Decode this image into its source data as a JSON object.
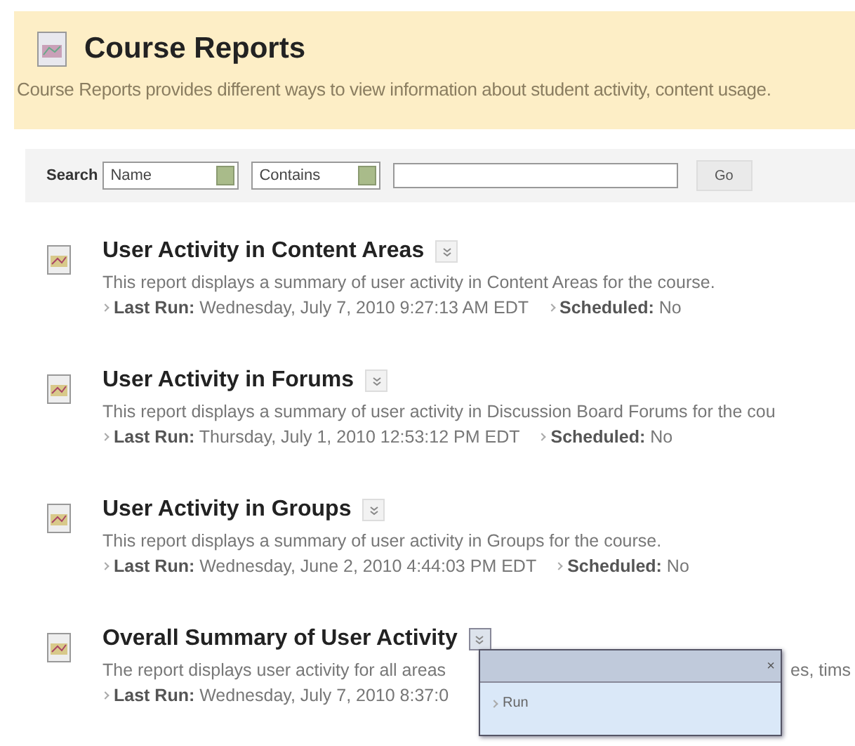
{
  "header": {
    "title": "Course Reports",
    "description": "Course Reports provides different ways to view information about student activity, content usage."
  },
  "search": {
    "label": "Search",
    "field_select": "Name",
    "operator_select": "Contains",
    "button": "Go"
  },
  "reports": [
    {
      "title": "User Activity in Content Areas",
      "description": "This report displays a summary of user activity in Content Areas for the course.",
      "last_run_label": "Last Run:",
      "last_run": "Wednesday, July 7, 2010 9:27:13 AM EDT",
      "scheduled_label": "Scheduled:",
      "scheduled": "No",
      "menu_open": false
    },
    {
      "title": "User Activity in Forums",
      "description": "This report displays a summary of user activity in Discussion Board Forums for the cou",
      "last_run_label": "Last Run:",
      "last_run": "Thursday, July 1, 2010 12:53:12 PM EDT",
      "scheduled_label": "Scheduled:",
      "scheduled": "No",
      "menu_open": false
    },
    {
      "title": "User Activity in Groups",
      "description": "This report displays a summary of user activity in Groups for the course.",
      "last_run_label": "Last Run:",
      "last_run": "Wednesday, June 2, 2010 4:44:03 PM EDT",
      "scheduled_label": "Scheduled:",
      "scheduled": "No",
      "menu_open": false
    },
    {
      "title": "Overall Summary of User Activity",
      "description": "The report displays user activity for all areas",
      "description_tail": "es, tims",
      "last_run_label": "Last Run:",
      "last_run": "Wednesday, July 7, 2010 8:37:0",
      "menu_open": true
    }
  ],
  "context_menu": {
    "close": "×",
    "items": [
      "Run"
    ]
  }
}
